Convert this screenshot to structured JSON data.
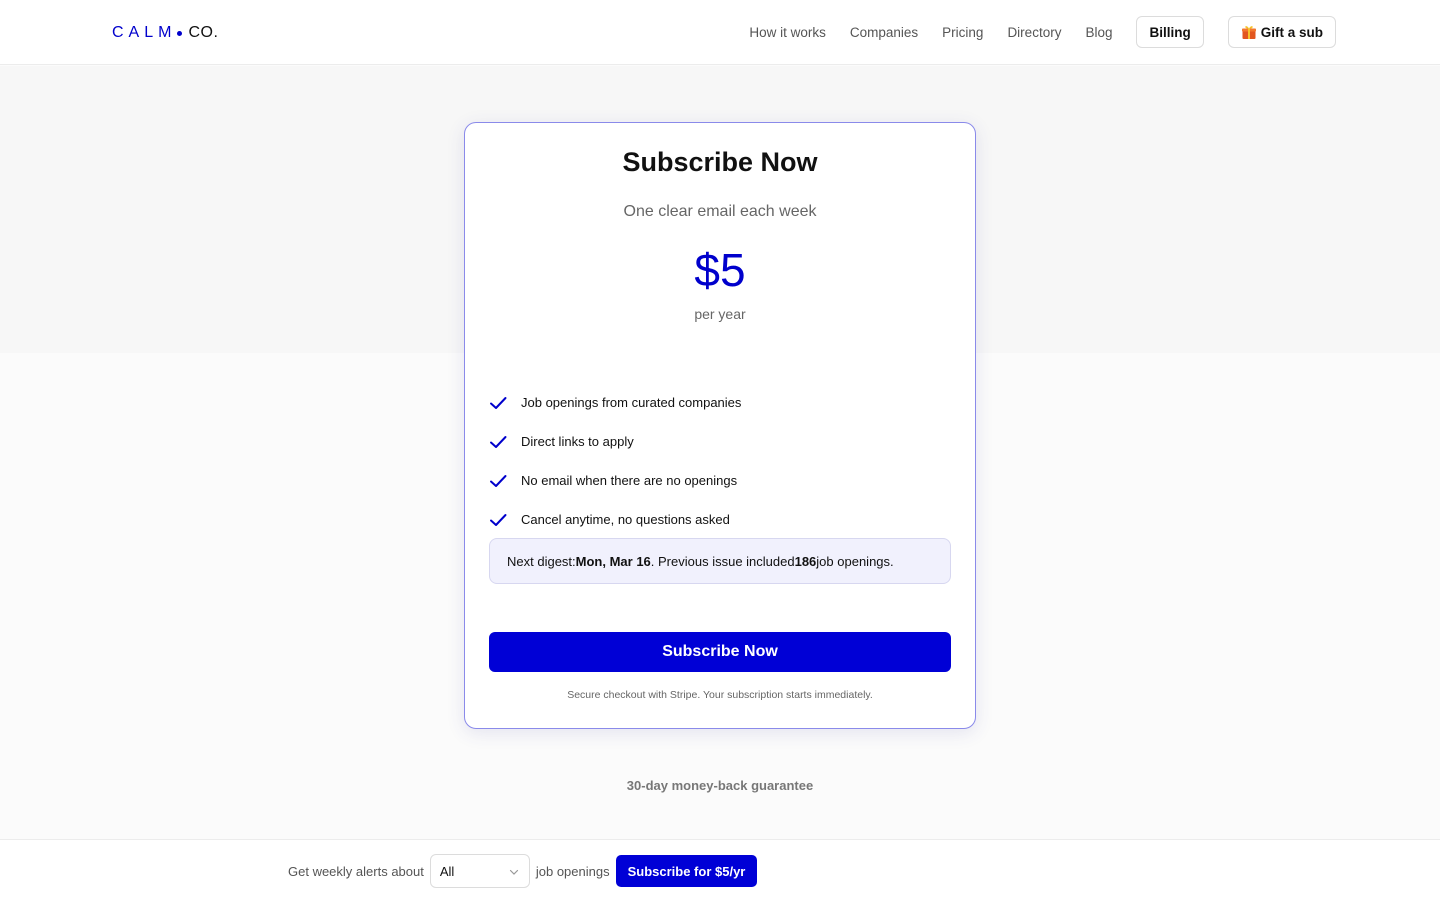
{
  "header": {
    "logo": {
      "left": "CALM",
      "right": "CO."
    },
    "nav": {
      "links": [
        "How it works",
        "Companies",
        "Pricing",
        "Directory",
        "Blog"
      ],
      "billing_label": "Billing",
      "gift_label": "Gift a sub",
      "gift_icon": "gift-icon"
    }
  },
  "card": {
    "title": "Subscribe Now",
    "subtitle": "One clear email each week",
    "price": "$5",
    "period": "per year",
    "check_icon": "check-icon",
    "features": [
      "Job openings from curated companies",
      "Direct links to apply",
      "No email when there are no openings",
      "Cancel anytime, no questions asked"
    ],
    "digest": {
      "prefix": "Next digest: ",
      "date": "Mon, Mar 16",
      "middle": ". Previous issue included ",
      "count": "186",
      "suffix": " job openings."
    },
    "cta_label": "Subscribe Now",
    "secure_note": "Secure checkout with Stripe. Your subscription starts immediately."
  },
  "guarantee": "30-day money-back guarantee",
  "footer": {
    "prefix": "Get weekly alerts about",
    "select_value": "All",
    "suffix": "job openings",
    "button_label": "Subscribe for $5/yr"
  },
  "colors": {
    "accent": "#0000cc",
    "button": "#0000d6",
    "card_border": "#8a8aea",
    "digest_bg": "#f1f1fd"
  }
}
